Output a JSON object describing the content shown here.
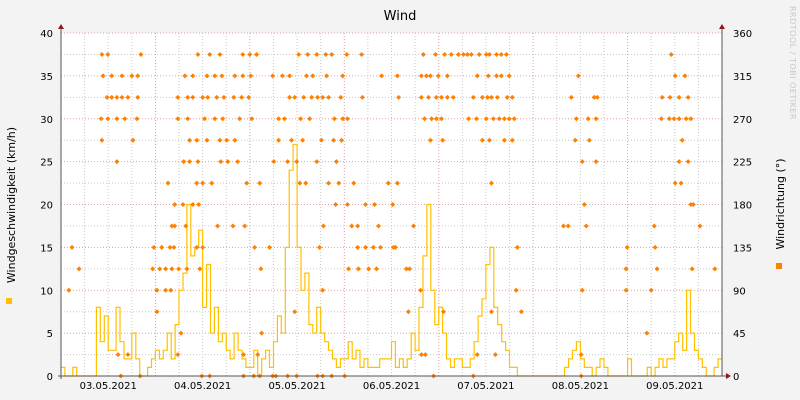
{
  "chart_data": {
    "type": "line",
    "title": "Wind",
    "ylabel": "Windgeschwindigkeit (km/h)",
    "y2label": "Windrichtung (°)",
    "watermark": "RRDTOOL / TOBI OETIKER",
    "ylim": [
      0,
      40
    ],
    "y2lim": [
      0,
      360
    ],
    "yticks": [
      "0",
      "5",
      "10",
      "15",
      "20",
      "25",
      "30",
      "35",
      "40"
    ],
    "y2ticks": [
      "0",
      "45",
      "90",
      "135",
      "180",
      "225",
      "270",
      "315",
      "360"
    ],
    "x_range_hours": [
      0,
      168
    ],
    "xtick_labels": [
      "03.05.2021",
      "04.05.2021",
      "05.05.2021",
      "06.05.2021",
      "07.05.2021",
      "08.05.2021",
      "09.05.2021"
    ],
    "grid": true,
    "colors": {
      "speed": "#ffc000",
      "direction": "#ff8000",
      "axis_arrow": "#8b1a1a",
      "major_grid": "#e0a0a0",
      "minor_grid": "#c8c8c8"
    },
    "series": [
      {
        "name": "Windgeschwindigkeit",
        "unit": "km/h",
        "style": "step",
        "hourly_values": [
          1,
          0,
          0,
          1,
          0,
          0,
          0,
          0,
          0,
          8,
          4,
          7,
          3,
          3,
          8,
          4,
          2,
          2,
          5,
          2,
          0,
          0,
          1,
          2,
          3,
          2,
          3,
          5,
          2,
          6,
          10,
          12,
          20,
          14,
          15,
          17,
          8,
          13,
          5,
          8,
          4,
          5,
          3,
          2,
          5,
          3,
          2,
          1,
          1,
          3,
          0,
          2,
          3,
          1,
          4,
          7,
          5,
          15,
          24,
          27,
          15,
          10,
          12,
          6,
          5,
          8,
          5,
          4,
          3,
          2,
          1,
          2,
          2,
          4,
          2,
          3,
          1,
          2,
          1,
          1,
          1,
          2,
          2,
          2,
          4,
          1,
          2,
          1,
          2,
          5,
          3,
          8,
          14,
          20,
          10,
          6,
          8,
          5,
          2,
          1,
          2,
          2,
          1,
          1,
          2,
          4,
          7,
          9,
          13,
          15,
          8,
          6,
          4,
          3,
          1,
          1,
          0,
          0,
          0,
          0,
          0,
          0,
          0,
          0,
          0,
          0,
          0,
          0,
          1,
          2,
          3,
          4,
          2,
          1,
          1,
          0,
          1,
          2,
          1,
          0,
          0,
          0,
          0,
          0,
          2,
          0,
          0,
          0,
          0,
          1,
          0,
          1,
          2,
          1,
          2,
          2,
          4,
          5,
          3,
          10,
          5,
          3,
          2,
          1,
          0,
          0,
          1,
          2
        ]
      },
      {
        "name": "Windrichtung",
        "unit": "°",
        "style": "points",
        "points_by_degree": {
          "337.5": [
            10.4,
            11.9,
            20.3,
            34.8,
            37.8,
            40.4,
            46.2,
            48.0,
            49.7,
            60.4,
            62.7,
            65.0,
            67.3,
            68.8,
            72.6,
            76.4,
            92.1,
            95.2,
            97.5,
            99.2,
            101.0,
            102.3,
            103.3,
            104.3,
            106.3,
            108.1,
            108.9,
            110.7,
            111.9,
            113.2,
            155.1
          ],
          "315": [
            10.7,
            12.9,
            15.5,
            18.0,
            19.5,
            31.5,
            33.5,
            37.1,
            39.1,
            40.9,
            44.2,
            46.2,
            48.2,
            53.8,
            56.3,
            58.1,
            62.4,
            64.0,
            67.5,
            71.6,
            81.5,
            85.5,
            91.6,
            92.9,
            93.9,
            95.9,
            98.2,
            105.8,
            108.6,
            110.7,
            111.9,
            113.9,
            131.5,
            156.1,
            158.6
          ],
          "292.5": [
            11.7,
            12.9,
            14.2,
            15.5,
            17.0,
            19.5,
            29.7,
            32.2,
            33.5,
            36.0,
            37.3,
            39.6,
            41.4,
            43.9,
            45.9,
            47.7,
            58.1,
            59.4,
            61.7,
            63.7,
            65.2,
            66.5,
            68.0,
            71.1,
            76.6,
            85.8,
            91.6,
            93.4,
            95.4,
            96.7,
            98.2,
            99.7,
            104.8,
            107.1,
            108.4,
            109.4,
            110.9,
            113.4,
            114.7,
            129.7,
            135.5,
            136.3,
            152.8,
            154.8,
            157.1,
            159.4
          ],
          "270": [
            10.2,
            11.9,
            14.2,
            16.2,
            19.3,
            29.7,
            32.2,
            36.5,
            39.1,
            41.1,
            45.4,
            48.5,
            55.3,
            56.8,
            60.9,
            63.2,
            69.5,
            71.6,
            72.8,
            92.4,
            94.2,
            95.4,
            96.7,
            103.6,
            105.6,
            108.1,
            109.9,
            111.4,
            112.7,
            113.9,
            115.2,
            131.0,
            134.0,
            136.0,
            152.6,
            154.6,
            155.8,
            157.1,
            158.9,
            160.1
          ],
          "247.5": [
            10.4,
            18.3,
            32.7,
            34.5,
            37.1,
            40.4,
            42.1,
            44.2,
            55.3,
            58.6,
            61.4,
            66.2,
            69.3,
            71.3,
            93.9,
            97.0,
            107.1,
            108.9,
            112.7,
            114.7,
            130.7,
            134.3,
            157.9
          ],
          "225": [
            14.2,
            31.2,
            32.7,
            34.8,
            40.6,
            42.4,
            44.9,
            54.1,
            57.6,
            59.9,
            65.0,
            70.0,
            132.5,
            136.0,
            157.1,
            159.4
          ],
          "202.5": [
            27.2,
            34.5,
            36.0,
            38.3,
            47.2,
            50.5,
            60.7,
            62.2,
            68.0,
            70.6,
            74.4,
            83.2,
            85.5,
            109.4,
            156.1,
            157.6
          ],
          "180": [
            28.9,
            31.0,
            33.5,
            35.0,
            69.8,
            72.8,
            77.4,
            79.7,
            84.3,
            133.0,
            160.1,
            160.7
          ],
          "157.5": [
            28.2,
            28.9,
            31.7,
            39.8,
            43.7,
            46.7,
            66.7,
            73.9,
            75.4,
            80.7,
            89.6,
            127.7,
            128.9,
            133.5,
            150.8,
            162.4
          ],
          "135": [
            2.8,
            23.6,
            25.6,
            27.7,
            28.7,
            34.5,
            36.0,
            49.2,
            53.0,
            65.7,
            75.4,
            77.4,
            79.4,
            81.2,
            84.5,
            85.0,
            116.0,
            143.9,
            151.0
          ],
          "112.5": [
            4.6,
            23.3,
            25.1,
            26.6,
            28.2,
            29.9,
            32.0,
            35.3,
            50.8,
            73.1,
            75.6,
            78.2,
            80.2,
            87.8,
            88.6,
            143.6,
            151.5,
            160.4,
            166.2
          ],
          "90": [
            2.0,
            24.4,
            26.6,
            27.9,
            66.5,
            91.4,
            115.7,
            132.5,
            143.6,
            150.0
          ],
          "67.5": [
            24.4,
            59.4,
            88.3,
            97.2,
            109.4,
            117.0
          ],
          "45": [
            30.5,
            51.0,
            148.9
          ],
          "22.5": [
            14.5,
            17.0,
            29.7,
            46.4,
            50.0,
            91.6,
            92.6,
            105.8,
            110.4,
            132.2
          ],
          "0": [
            15.2,
            20.1,
            35.8,
            37.8,
            46.4,
            49.0,
            50.5,
            53.8,
            54.6,
            57.6,
            59.9,
            65.2,
            66.5,
            68.8,
            72.1,
            94.7,
            104.8,
            132.2
          ]
        }
      }
    ]
  }
}
